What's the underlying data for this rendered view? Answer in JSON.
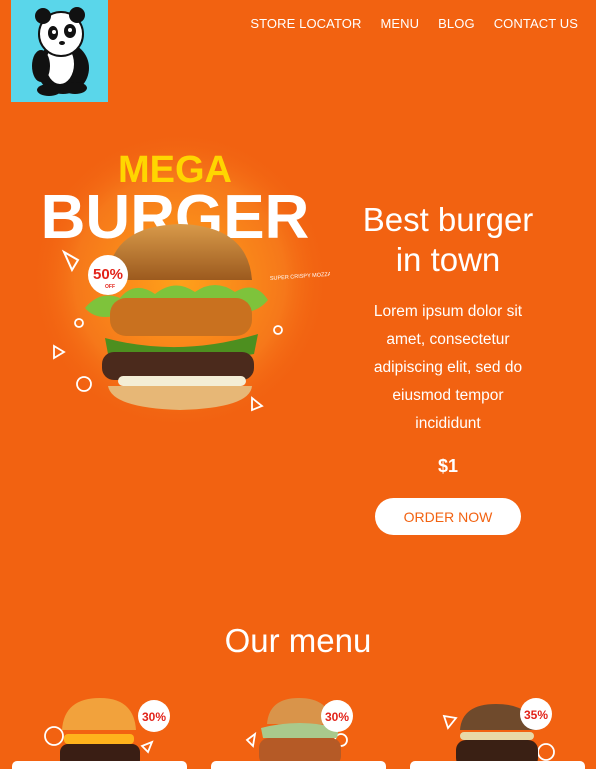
{
  "nav": {
    "items": [
      {
        "label": "STORE LOCATOR"
      },
      {
        "label": "MENU"
      },
      {
        "label": "BLOG"
      },
      {
        "label": "CONTACT US"
      }
    ]
  },
  "hero_image": {
    "headline_top": "MEGA",
    "headline_main": "BURGER",
    "badge_percent": "50%",
    "badge_sub": "OFF",
    "side_note": "SUPER CRISPY MOZZARELLA & ONION RING"
  },
  "hero": {
    "title_line1": "Best burger",
    "title_line2": "in town",
    "description": "Lorem ipsum dolor sit amet, consectetur adipiscing elit, sed do eiusmod tempor incididunt",
    "price": "$1",
    "order_label": "ORDER NOW"
  },
  "menu": {
    "title": "Our menu",
    "items": [
      {
        "badge": "30%"
      },
      {
        "badge": "30%"
      },
      {
        "badge": "35%"
      }
    ]
  },
  "colors": {
    "background": "#f26211",
    "logo_bg": "#5ad6ea",
    "accent_yellow": "#ffd600",
    "badge_red": "#e2231a"
  }
}
